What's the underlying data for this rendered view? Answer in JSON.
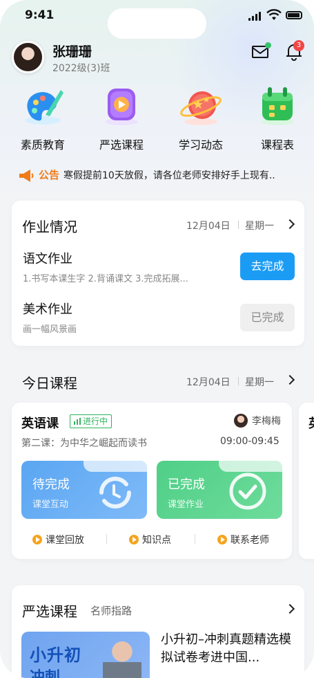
{
  "status_bar": {
    "time": "9:41"
  },
  "user": {
    "name": "张珊珊",
    "class": "2022级(3)班"
  },
  "header": {
    "message_icon": "mail-icon",
    "notification_icon": "bell-icon",
    "notification_count": "3",
    "online_dot_color": "#36c46a"
  },
  "quick_menu": [
    {
      "label": "素质教育",
      "icon": "palette-icon"
    },
    {
      "label": "严选课程",
      "icon": "video-play-icon"
    },
    {
      "label": "学习动态",
      "icon": "planet-icon"
    },
    {
      "label": "课程表",
      "icon": "calendar-icon"
    }
  ],
  "notice": {
    "tag": "公告",
    "text": "寒假提前10天放假，请各位老师安排好手上现有.."
  },
  "homework": {
    "title": "作业情况",
    "date": "12月04日",
    "weekday": "星期一",
    "items": [
      {
        "name": "语文作业",
        "desc": "1.书写本课生字  2.背诵课文  3.完成拓展...",
        "action": "去完成"
      },
      {
        "name": "美术作业",
        "desc": "画一幅风景画",
        "action": "已完成"
      }
    ]
  },
  "today_courses": {
    "title": "今日课程",
    "date": "12月04日",
    "weekday": "星期一",
    "course": {
      "name": "英语课",
      "status": "进行中",
      "teacher": "李梅梅",
      "lesson": "第二课：为中华之崛起而读书",
      "time": "09:00-09:45",
      "tiles": [
        {
          "title": "待完成",
          "subtitle": "课堂互动",
          "color": "#5aa6f2"
        },
        {
          "title": "已完成",
          "subtitle": "课堂作业",
          "color": "#4fcf87"
        }
      ],
      "links": [
        "课堂回放",
        "知识点",
        "联系老师"
      ]
    },
    "next_card_title": "英"
  },
  "selected_courses": {
    "title": "严选课程",
    "subtitle": "名师指路",
    "book": {
      "cover_title": "小升初",
      "cover_sub": "冲刺",
      "title": "小升初–冲刺真题精选模拟试卷考进中国..."
    }
  }
}
